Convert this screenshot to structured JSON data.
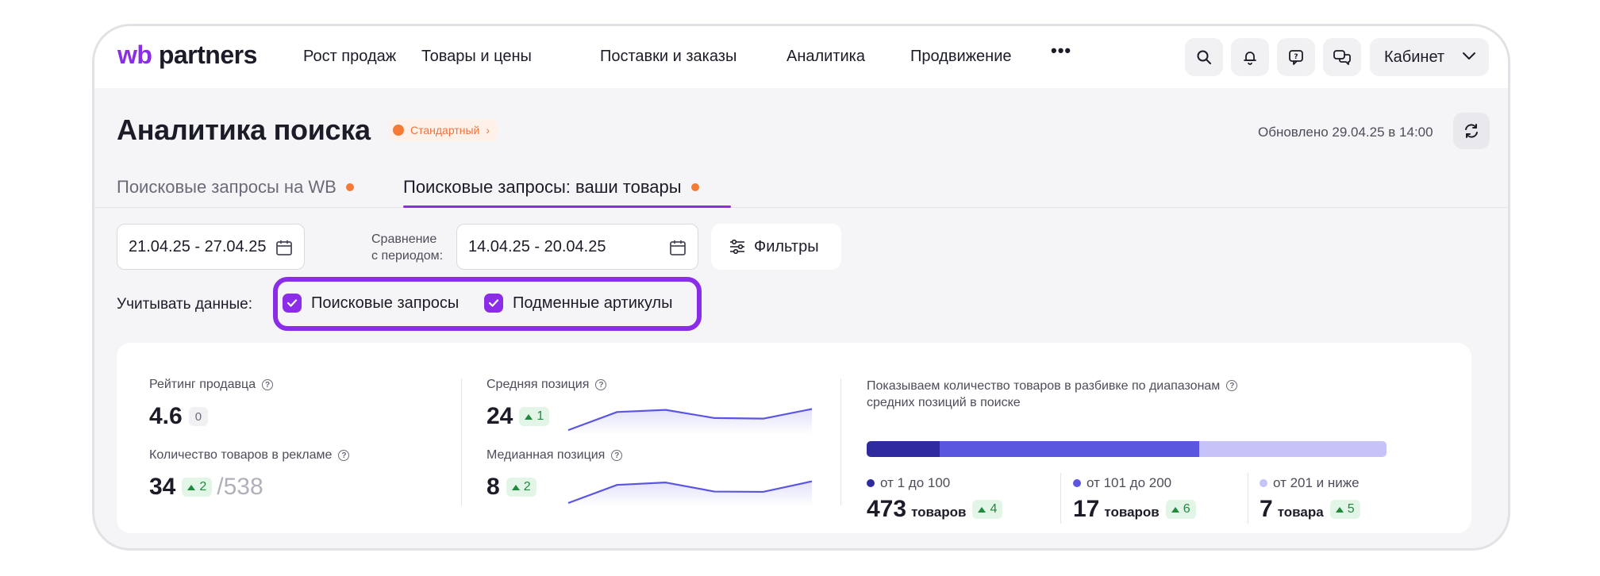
{
  "brand": {
    "wb": "wb",
    "partners": "partners"
  },
  "nav": {
    "items": [
      "Рост продаж",
      "Товары и цены",
      "Поставки и заказы",
      "Аналитика",
      "Продвижение"
    ],
    "more": "•••",
    "cabinet": "Кабинет"
  },
  "header": {
    "title": "Аналитика поиска",
    "badge": "Стандартный",
    "updated": "Обновлено 29.04.25 в 14:00"
  },
  "tabs": [
    {
      "label": "Поисковые запросы на WB"
    },
    {
      "label": "Поисковые запросы: ваши товары"
    }
  ],
  "filters": {
    "period": "21.04.25 - 27.04.25",
    "compare_label_1": "Сравнение",
    "compare_label_2": "с периодом:",
    "compare_period": "14.04.25 - 20.04.25",
    "filters_button": "Фильтры"
  },
  "consider": {
    "label": "Учитывать данные:",
    "options": [
      {
        "label": "Поисковые запросы",
        "checked": true
      },
      {
        "label": "Подменные артикулы",
        "checked": true
      }
    ]
  },
  "stats": {
    "seller_rating": {
      "label": "Рейтинг продавца",
      "value": "4.6",
      "delta": "0"
    },
    "ad_products": {
      "label": "Количество товаров в рекламе",
      "value": "34",
      "delta": "2",
      "total": "/538"
    },
    "avg_position": {
      "label": "Средняя позиция",
      "value": "24",
      "delta": "1",
      "trend": [
        0.05,
        0.65,
        0.72,
        0.45,
        0.43,
        0.75
      ]
    },
    "median_position": {
      "label": "Медианная позиция",
      "value": "8",
      "delta": "2",
      "trend": [
        0.0,
        0.6,
        0.68,
        0.38,
        0.37,
        0.72
      ]
    },
    "distribution": {
      "label_line1": "Показываем количество товаров в разбивке по диапазонам",
      "label_line2": "средних позиций в поиске",
      "ranges": [
        {
          "label": "от 1 до 100",
          "value": "473",
          "unit": "товаров",
          "delta": "4",
          "share": 0.14,
          "color": "#2e2b9e"
        },
        {
          "label": "от 101 до 200",
          "value": "17",
          "unit": "товаров",
          "delta": "6",
          "share": 0.5,
          "color": "#5b56e0"
        },
        {
          "label": "от 201 и ниже",
          "value": "7",
          "unit": "товара",
          "delta": "5",
          "share": 0.36,
          "color": "#c5c3f7"
        }
      ]
    }
  },
  "colors": {
    "accent": "#8b2ce8",
    "orange": "#f47a36",
    "green": "#1f8a3d",
    "line": "#5b56e0"
  }
}
